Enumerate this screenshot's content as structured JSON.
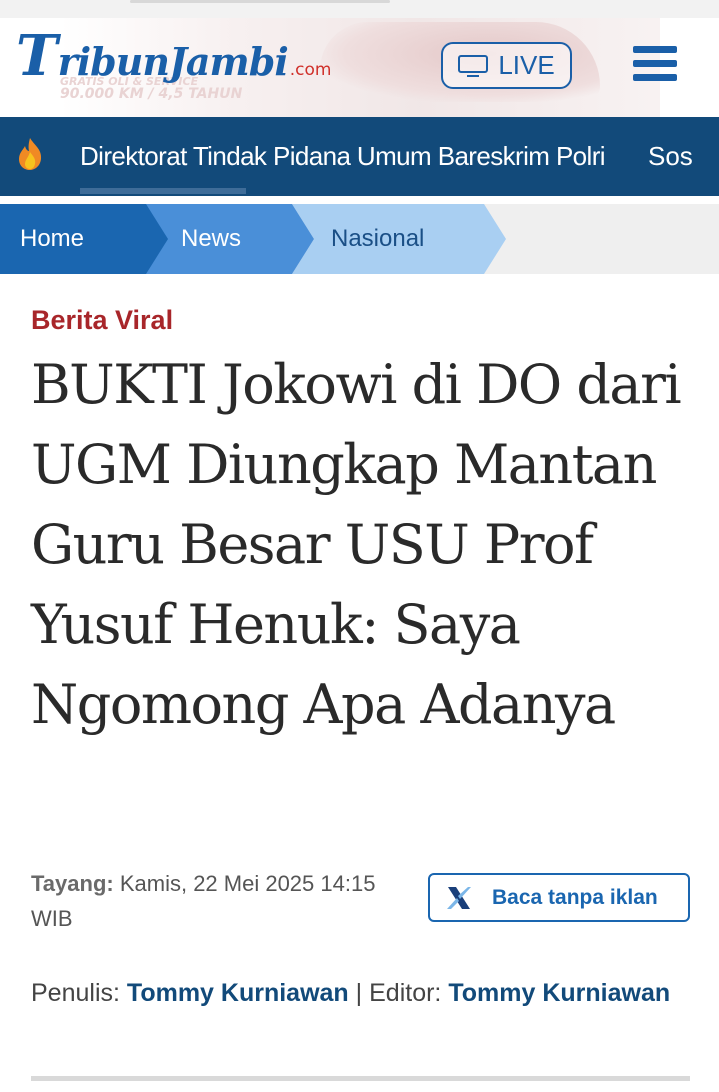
{
  "header": {
    "logo_main": "TribunJambi",
    "logo_first": "T",
    "logo_rest": "ribunJambi",
    "logo_suffix": ".com",
    "ad_line1": "GRATIS OLI & SERVICE",
    "ad_line2": "90.000 KM / 4,5 TAHUN",
    "live_label": "LIVE"
  },
  "ticker": {
    "items": [
      "Direktorat Tindak Pidana Umum Bareskrim Polri",
      "Sos"
    ]
  },
  "breadcrumb": {
    "items": [
      {
        "label": "Home"
      },
      {
        "label": "News"
      },
      {
        "label": "Nasional"
      }
    ]
  },
  "article": {
    "category": "Berita Viral",
    "title": "BUKTI Jokowi di DO dari UGM Diungkap Mantan Guru Besar USU Prof Yusuf Henuk: Saya Ngomong Apa Adanya",
    "published_label": "Tayang:",
    "published_value": "Kamis, 22 Mei 2025 14:15 WIB",
    "ad_free_button": "Baca tanpa iklan",
    "writer_label": "Penulis:",
    "writer": "Tommy Kurniawan",
    "separator": "|",
    "editor_label": "Editor:",
    "editor": "Tommy Kurniawan"
  },
  "colors": {
    "brand_blue": "#1a5fa8",
    "ticker_bg": "#124a7a",
    "category_red": "#a8262a"
  },
  "icons": [
    "tv-icon",
    "hamburger-menu-icon",
    "fire-icon",
    "x-logo-icon"
  ]
}
